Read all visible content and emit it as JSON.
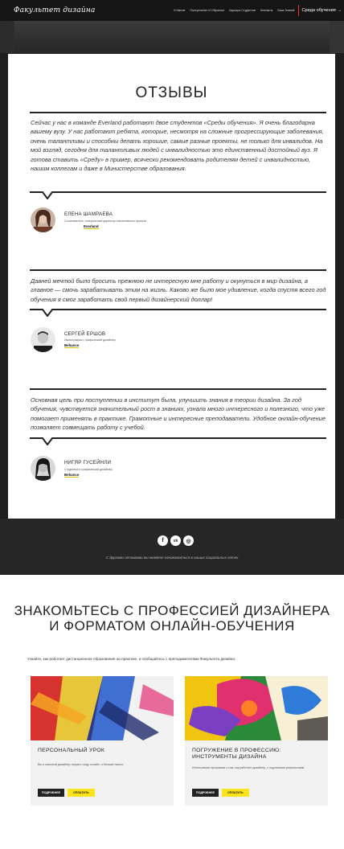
{
  "nav": {
    "logo": "Факультет дизайна",
    "links": [
      "О Школе",
      "Поступление И Обучение",
      "Карьера Студентов",
      "Контакты",
      "База Знаний"
    ],
    "cta": "Среда обучения →"
  },
  "reviews": {
    "title": "ОТЗЫВЫ",
    "items": [
      {
        "text": "Сейчас у нас в команде Everland работают двое студентов «Среды обучения». Я очень благодарна вашему вузу. У нас работают ребята, которые, несмотря на сложные прогрессирующие заболевания, очень талантливы и способны делать хорошие, самые разные проекты, не только для инвалидов. На мой взгляд, сегодня для талантливых людей с инвалидностью это единственный достойный вуз. Я готова ставить «Среду» в пример, всячески рекомендовать родителям детей с инвалидностью, нашим коллегам и даже в Министерстве образования.",
        "name": "ЕЛЕНА ШАМРАЕВА",
        "role": "Сооснователь, генеральный директор инклюзивного проекта",
        "link": "Everland"
      },
      {
        "text": "Давней мечтой было бросить прежнюю не интересную мне работу и окунуться в мир дизайна, а главное — смочь зарабатывать этим на жизнь. Каково же было мое удивление, когда спустя всего год обучения я смог заработать свой первый дизайнерский доллар!",
        "name": "СЕРГЕЙ ЕРШОВ",
        "role": "Иконографист, графический дизайнер",
        "link": "Behance"
      },
      {
        "text": "Основная цель при поступлении в институт была, улучшить знания в теории дизайна. За год обучения, чувствуется значительный рост в знаниях, узнала много интересного и полезного, что уже помогает применять в практике. Грамотные и интересные преподаватели. Удобное онлайн-обучение позволяет совмещать работу с учебой.",
        "name": "НИГЯР ГУСЕЙНЛИ",
        "role": "Студентка и графический дизайнер",
        "link": "Behance"
      }
    ]
  },
  "social": {
    "icons": [
      "facebook-icon",
      "vk-icon",
      "instagram-icon"
    ],
    "glyphs": [
      "f",
      "vk",
      "◎"
    ],
    "text": "С другими отзывами вы можете ознакомиться в наших социальных сетях"
  },
  "courses": {
    "title_line1": "ЗНАКОМЬТЕСЬ С ПРОФЕССИЕЙ ДИЗАЙНЕРА",
    "title_line2": "И ФОРМАТОМ ОНЛАЙН-ОБУЧЕНИЯ",
    "intro": "Узнайте, как работает дистанционное образование на практике, и пообщайтесь с преподавателями Факультета дизайна:",
    "items": [
      {
        "title": "ПЕРСОНАЛЬНЫЙ УРОК",
        "desc": "Вы и опытный дизайнер лицом к лицу онлайн, и больше никого",
        "more": "ПОДРОБНЕЕ",
        "pay": "ОПЛАТИТЬ"
      },
      {
        "title": "ПОГРУЖЕНИЕ В ПРОФЕССИЮ: ИНСТРУМЕНТЫ ДИЗАЙНА",
        "desc": "Интенсивная программа о том, как работает дизайнер, с ощутимыми результатами",
        "more": "ПОДРОБНЕЕ",
        "pay": "ОПЛАТИТЬ"
      }
    ]
  }
}
